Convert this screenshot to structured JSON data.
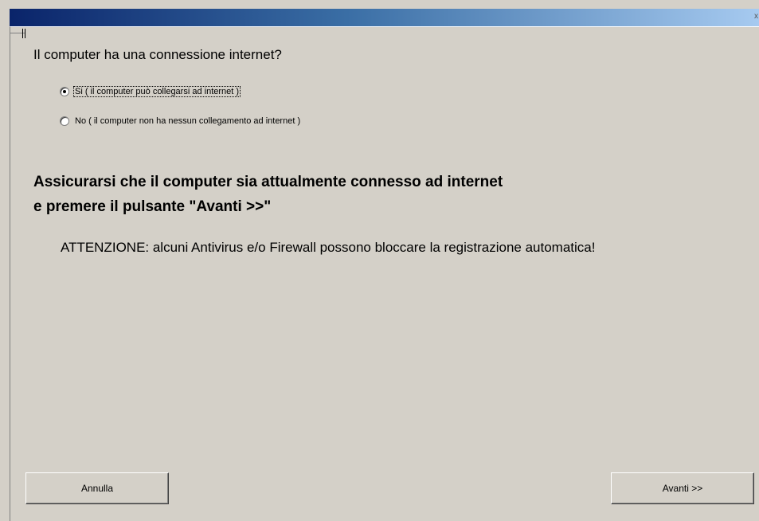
{
  "window": {
    "close_glyph": "x"
  },
  "question": "Il computer ha una connessione internet?",
  "options": [
    {
      "label": "Si ( il computer può collegarsi ad internet )",
      "selected": true
    },
    {
      "label": "No ( il computer non ha nessun collegamento ad internet )",
      "selected": false
    }
  ],
  "instruction": {
    "line1": "Assicurarsi che il computer sia attualmente connesso ad internet",
    "line2": "e premere il pulsante \"Avanti >>\""
  },
  "warning": "ATTENZIONE: alcuni Antivirus e/o Firewall possono bloccare la registrazione automatica!",
  "buttons": {
    "cancel": "Annulla",
    "next": "Avanti >>"
  },
  "colors": {
    "titlebar_start": "#0a246a",
    "titlebar_end": "#a6caf0",
    "face": "#d4d0c8"
  },
  "icons": [
    "close-icon",
    "radio-selected",
    "radio-unselected"
  ]
}
